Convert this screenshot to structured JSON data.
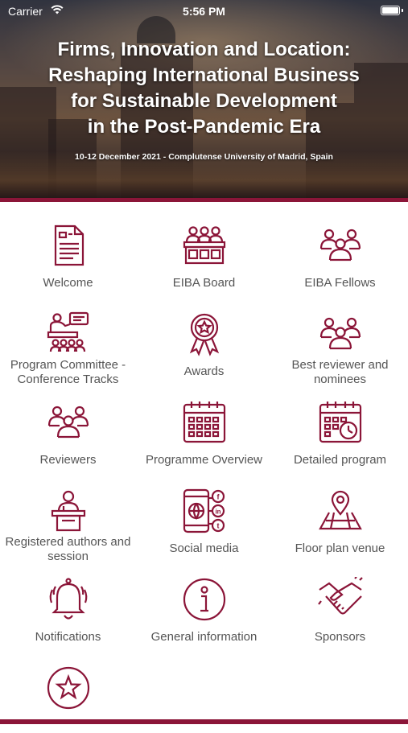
{
  "status_bar": {
    "carrier": "Carrier",
    "time": "5:56 PM"
  },
  "header": {
    "title_lines": [
      "Firms, Innovation and Location:",
      "Reshaping International Business",
      "for Sustainable Development",
      "in the Post-Pandemic Era"
    ],
    "subtitle": "10-12 December 2021 - Complutense University of Madrid, Spain"
  },
  "accent_color": "#8b1538",
  "menu": [
    {
      "label": "Welcome",
      "icon": "document-icon"
    },
    {
      "label": "EIBA Board",
      "icon": "board-icon"
    },
    {
      "label": "EIBA Fellows",
      "icon": "group-icon"
    },
    {
      "label": "Program Committee - Conference Tracks",
      "icon": "presenter-icon"
    },
    {
      "label": "Awards",
      "icon": "award-icon"
    },
    {
      "label": "Best reviewer and nominees",
      "icon": "group-icon"
    },
    {
      "label": "Reviewers",
      "icon": "group-icon"
    },
    {
      "label": "Programme Overview",
      "icon": "calendar-icon"
    },
    {
      "label": "Detailed program",
      "icon": "calendar-clock-icon"
    },
    {
      "label": "Registered authors and session",
      "icon": "speaker-icon"
    },
    {
      "label": "Social media",
      "icon": "social-media-icon"
    },
    {
      "label": "Floor plan venue",
      "icon": "map-pin-icon"
    },
    {
      "label": "Notifications",
      "icon": "bell-icon"
    },
    {
      "label": "General information",
      "icon": "info-icon"
    },
    {
      "label": "Sponsors",
      "icon": "handshake-icon"
    },
    {
      "label": "",
      "icon": "star-circle-icon"
    }
  ]
}
